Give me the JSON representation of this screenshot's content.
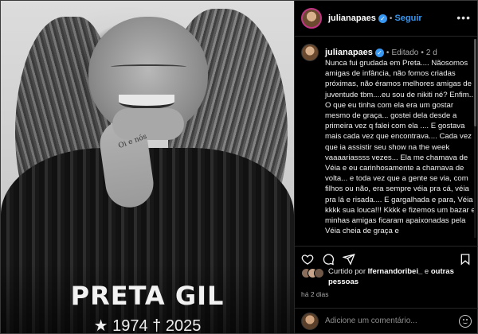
{
  "post_image": {
    "name_text": "PRETA GIL",
    "years_text": "★ 1974 † 2025",
    "tattoo_text": "Oi e nós"
  },
  "header": {
    "username": "julianapaes",
    "follow_label": "Seguir",
    "more_icon": "more-horizontal-icon"
  },
  "caption": {
    "username": "julianapaes",
    "edited_label": "Editado",
    "time": "2 d",
    "text": "Nunca fui grudada em Preta.... Nãosomos amigas de infância, não fomos criadas próximas, não éramos melhores amigas de juventude tbm....eu sou de nikiti né? Enfim... O que eu tinha com ela era um gostar mesmo de graça... gostei dela desde a primeira vez q falei com ela .... E gostava mais cada vez que encontrava.... Cada vez que ia assistir seu show na the week vaaaariassss vezes... Ela me chamava de Véia e eu carinhosamente a chamava de volta... e toda vez que a gente se via, com filhos ou não, era sempre véia pra cá, véia pra lá e risada.... E gargalhada e para, Véia kkkk sua louca!!! Kkkk e fizemos um bazar e minhas amigas ficaram apaixonadas pela Véia cheia de graça e"
  },
  "actions": {
    "like_icon": "heart-icon",
    "comment_icon": "comment-icon",
    "share_icon": "share-icon",
    "save_icon": "bookmark-icon"
  },
  "likes": {
    "prefix": "Curtido por",
    "user": "lfernandoribei_",
    "conj": "e",
    "others": "outras pessoas"
  },
  "timeago": "há 2 dias",
  "comment": {
    "placeholder": "Adicione um comentário...",
    "emoji_icon": "emoji-icon"
  },
  "colors": {
    "accent": "#3897f0",
    "background": "#000000",
    "divider": "#262626"
  }
}
